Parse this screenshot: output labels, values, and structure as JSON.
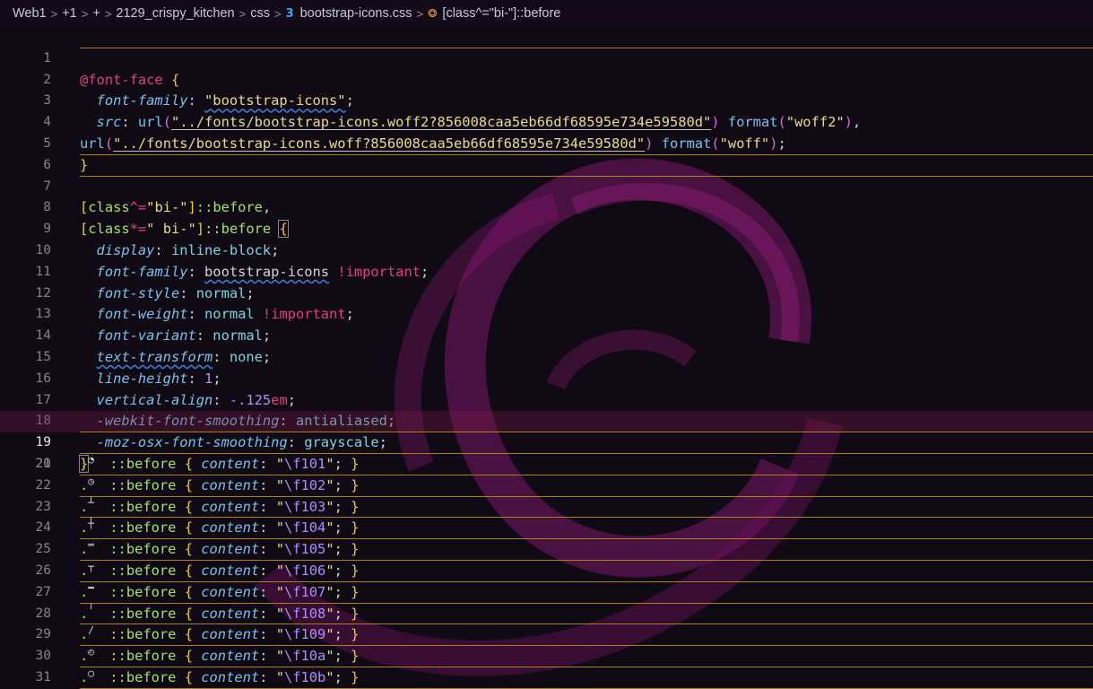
{
  "breadcrumb": {
    "items": [
      "Web1",
      "+1",
      "+",
      "2129_crispy_kitchen",
      "css"
    ],
    "file": "bootstrap-icons.css",
    "symbol": "[class^=\"bi-\"]::before"
  },
  "icons": {
    "file_icon": "css3-icon",
    "symbol_icon": "symbol-structure-icon",
    "separator_icon": "chevron-right-icon"
  },
  "colors": {
    "keyword": "#e5407e",
    "property": "#7dc2e8",
    "string": "#eadc8d",
    "selector": "#a5e06a",
    "highlight_border": "#b07d1c"
  },
  "editor": {
    "active_line": 19,
    "line_numbers": [
      "1",
      "2",
      "3",
      "4",
      "5",
      "6",
      "7",
      "8",
      "9",
      "10",
      "11",
      "12",
      "13",
      "14",
      "15",
      "16",
      "17",
      "18",
      "19",
      "20",
      "21",
      "22",
      "23",
      "24",
      "25",
      "26",
      "27",
      "28",
      "29",
      "30",
      "31"
    ],
    "tokens": {
      "font_face": "@font-face",
      "font_family_prop": "font-family",
      "font_family_val": "\"bootstrap-icons\"",
      "src_prop": "src",
      "url_fn": "url",
      "woff2_url": "\"../fonts/bootstrap-icons.woff2?856008caa5eb66df68595e734e59580d\"",
      "format_fn": "format",
      "woff2": "\"woff2\"",
      "woff_url": "\"../fonts/bootstrap-icons.woff?856008caa5eb66df68595e734e59580d\"",
      "woff": "\"woff\"",
      "sel7_attr": "class",
      "sel7_op": "^=",
      "sel7_val": "\"bi-\"",
      "sel8_op": "*=",
      "sel8_val": "\" bi-\"",
      "pseudo_before": "::before",
      "display_prop": "display",
      "display_val": "inline-block",
      "ff_val": "bootstrap-icons",
      "important": "!important",
      "font_style_prop": "font-style",
      "normal": "normal",
      "font_weight_prop": "font-weight",
      "font_variant_prop": "font-variant",
      "text_transform_prop": "text-transform",
      "none": "none",
      "line_height_prop": "line-height",
      "line_height_val": "1",
      "vertical_align_prop": "vertical-align",
      "va_num": "-.125",
      "va_unit": "em",
      "webkit_prop": "-webkit-font-smoothing",
      "antialiased": "antialiased",
      "moz_prop": "-moz-osx-font-smoothing",
      "grayscale": "grayscale",
      "content_prop": "content"
    },
    "icon_rules": [
      {
        "glyph": "◔",
        "code": "f101"
      },
      {
        "glyph": "◷",
        "code": "f102"
      },
      {
        "glyph": "┴",
        "code": "f103"
      },
      {
        "glyph": "┼",
        "code": "f104"
      },
      {
        "glyph": "═",
        "code": "f105"
      },
      {
        "glyph": "┬",
        "code": "f106"
      },
      {
        "glyph": "━",
        "code": "f107"
      },
      {
        "glyph": "╵",
        "code": "f108"
      },
      {
        "glyph": "∕",
        "code": "f109"
      },
      {
        "glyph": "◴",
        "code": "f10a"
      },
      {
        "glyph": "◯",
        "code": "f10b"
      }
    ]
  }
}
